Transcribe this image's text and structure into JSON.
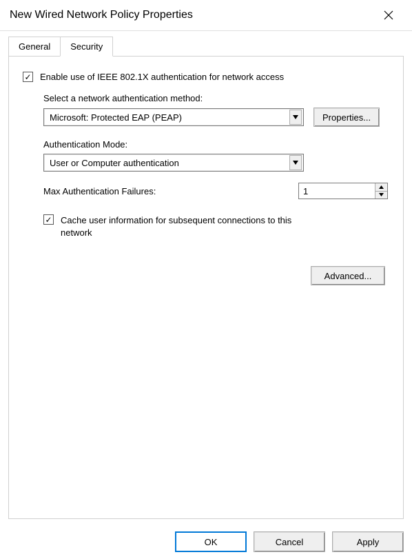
{
  "window": {
    "title": "New Wired Network Policy Properties"
  },
  "tabs": {
    "general": "General",
    "security": "Security",
    "active": "security"
  },
  "security": {
    "enable_8021x_label": "Enable use of IEEE 802.1X authentication for network access",
    "enable_8021x_checked": true,
    "auth_method_label": "Select a network authentication method:",
    "auth_method_value": "Microsoft: Protected EAP (PEAP)",
    "properties_button": "Properties...",
    "auth_mode_label": "Authentication Mode:",
    "auth_mode_value": "User or Computer authentication",
    "max_auth_fail_label": "Max Authentication Failures:",
    "max_auth_fail_value": "1",
    "cache_checked": true,
    "cache_label": "Cache user information for subsequent connections to this network",
    "advanced_button": "Advanced..."
  },
  "footer": {
    "ok": "OK",
    "cancel": "Cancel",
    "apply": "Apply"
  }
}
